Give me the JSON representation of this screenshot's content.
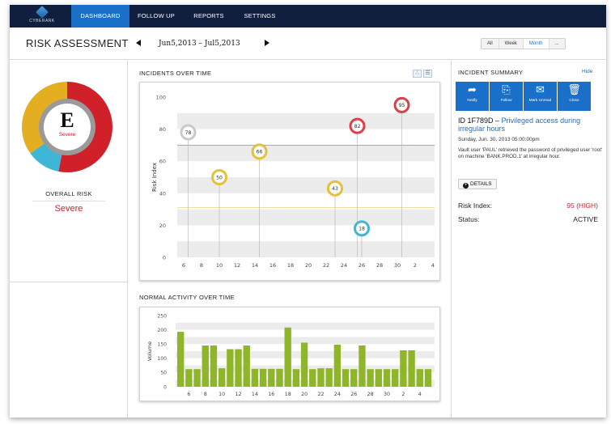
{
  "app": {
    "logo_text": "CYBERARK"
  },
  "nav": {
    "tabs": [
      {
        "label": "DASHBOARD",
        "active": true
      },
      {
        "label": "FOLLOW UP"
      },
      {
        "label": "REPORTS"
      },
      {
        "label": "SETTINGS"
      }
    ]
  },
  "header": {
    "title": "RISK ASSESSMENT",
    "date_range": "Jun5,2013 – Jul5,2013",
    "period_options": [
      "All",
      "Week",
      "Month",
      "..."
    ],
    "period_selected": "Month"
  },
  "overall": {
    "grade": "E",
    "grade_label": "Severe",
    "label": "OVERALL RISK",
    "value": "Severe",
    "segments": [
      {
        "name": "red",
        "fraction": 0.53,
        "color": "#d0202a"
      },
      {
        "name": "cyan",
        "fraction": 0.12,
        "color": "#40b6d6"
      },
      {
        "name": "yellow",
        "fraction": 0.35,
        "color": "#e3ae1f"
      }
    ]
  },
  "incidents_chart": {
    "title": "INCIDENTS OVER TIME",
    "chart_data": {
      "type": "scatter",
      "ylabel": "Risk Index",
      "ylim": [
        0,
        100
      ],
      "yticks": [
        0,
        20,
        40,
        60,
        80,
        100
      ],
      "x_ticks": [
        "6",
        "8",
        "10",
        "12",
        "14",
        "16",
        "18",
        "20",
        "22",
        "24",
        "26",
        "28",
        "30",
        "2",
        "4"
      ],
      "thresholds": [
        {
          "value": 70,
          "color": "#e0736a"
        },
        {
          "value": 31,
          "color": "#ecd57d"
        }
      ],
      "points": [
        {
          "x": "6.5",
          "y": 78,
          "label": "78",
          "color": "#c9c9c9"
        },
        {
          "x": "10",
          "y": 50,
          "label": "50",
          "color": "#e3c23a"
        },
        {
          "x": "14.5",
          "y": 66,
          "label": "66",
          "color": "#e3c23a"
        },
        {
          "x": "23",
          "y": 43,
          "label": "43",
          "color": "#e3c23a"
        },
        {
          "x": "25.5",
          "y": 82,
          "label": "82",
          "color": "#d9404a"
        },
        {
          "x": "26",
          "y": 18,
          "label": "18",
          "color": "#40b6d6"
        },
        {
          "x": "30.5",
          "y": 95,
          "label": "95",
          "color": "#d9404a"
        }
      ]
    }
  },
  "activity_chart": {
    "title": "NORMAL ACTIVITY OVER TIME",
    "chart_data": {
      "type": "bar",
      "ylabel": "Volume",
      "ylim": [
        0,
        250
      ],
      "yticks": [
        0,
        50,
        100,
        150,
        200,
        250
      ],
      "x_ticks": [
        "6",
        "8",
        "10",
        "12",
        "14",
        "16",
        "18",
        "20",
        "22",
        "24",
        "26",
        "28",
        "30",
        "2",
        "4"
      ],
      "values": [
        193,
        62,
        62,
        145,
        145,
        65,
        132,
        132,
        145,
        63,
        63,
        63,
        63,
        208,
        62,
        155,
        62,
        65,
        65,
        148,
        62,
        62,
        145,
        62,
        62,
        62,
        62,
        128,
        128,
        62,
        62
      ],
      "color": "#8fb52a"
    }
  },
  "summary": {
    "title": "INCIDENT SUMMARY",
    "hide_label": "Hide",
    "actions": [
      {
        "label": "Notify",
        "icon": "share-icon",
        "glyph": "➦"
      },
      {
        "label": "Follow",
        "icon": "follow-icon",
        "glyph": "⎘"
      },
      {
        "label": "Mark Unread",
        "icon": "mail-icon",
        "glyph": "✉"
      },
      {
        "label": "Close",
        "icon": "trash-icon",
        "glyph": "🗑"
      }
    ],
    "id": "ID 1F789D –",
    "headline": "Privileged access during irregular hours",
    "date": "Sunday, Jun. 30, 2013 05:00:00pm",
    "description": "Vault user 'PAUL' retrieved the password of privileged user 'root' on machine 'BANK.PROD.1' at irregular  hour.",
    "details_label": "DETAILS",
    "risk_label": "Risk Index:",
    "risk_value": "95 (HIGH)",
    "status_label": "Status:",
    "status_value": "ACTIVE"
  }
}
